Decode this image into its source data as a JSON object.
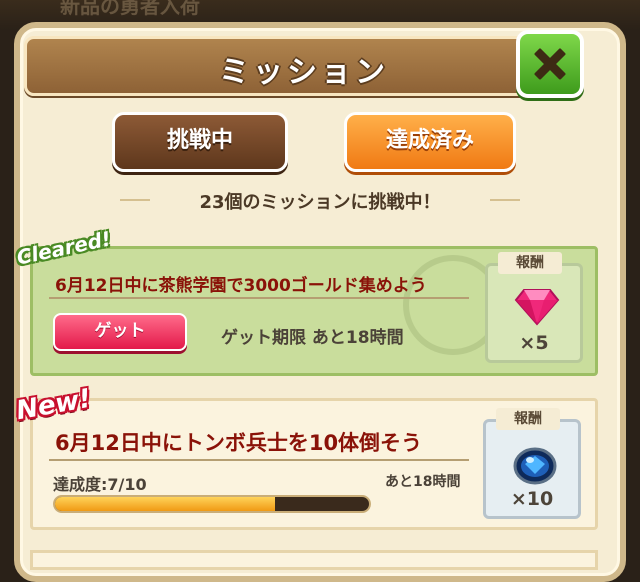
{
  "background": {
    "partial_text": "新品の勇者入荷"
  },
  "header": {
    "title": "ミッション"
  },
  "tabs": [
    {
      "label": "挑戦中",
      "active": true
    },
    {
      "label": "達成済み",
      "active": false
    }
  ],
  "summary": "23個のミッションに挑戦中！",
  "missions": [
    {
      "badge": "Cleared!",
      "description": "6月12日中に茶熊学園で3000ゴールド集めよう",
      "action_label": "ゲット",
      "deadline": "ゲット期限 あと18時間",
      "reward_label": "報酬",
      "reward_icon": "gem-icon",
      "reward_qty": "×5"
    },
    {
      "badge": "New!",
      "description": "6月12日中にトンボ兵士を10体倒そう",
      "progress_label": "達成度:7/10",
      "progress": 0.7,
      "time_left": "あと18時間",
      "reward_label": "報酬",
      "reward_icon": "blue-orb-icon",
      "reward_qty": "×10"
    }
  ],
  "colors": {
    "accent_green": "#3e9b1c",
    "cleared_bg": "#c9dd9c",
    "mission_text": "#8a1208",
    "get_button": "#e3194a"
  }
}
